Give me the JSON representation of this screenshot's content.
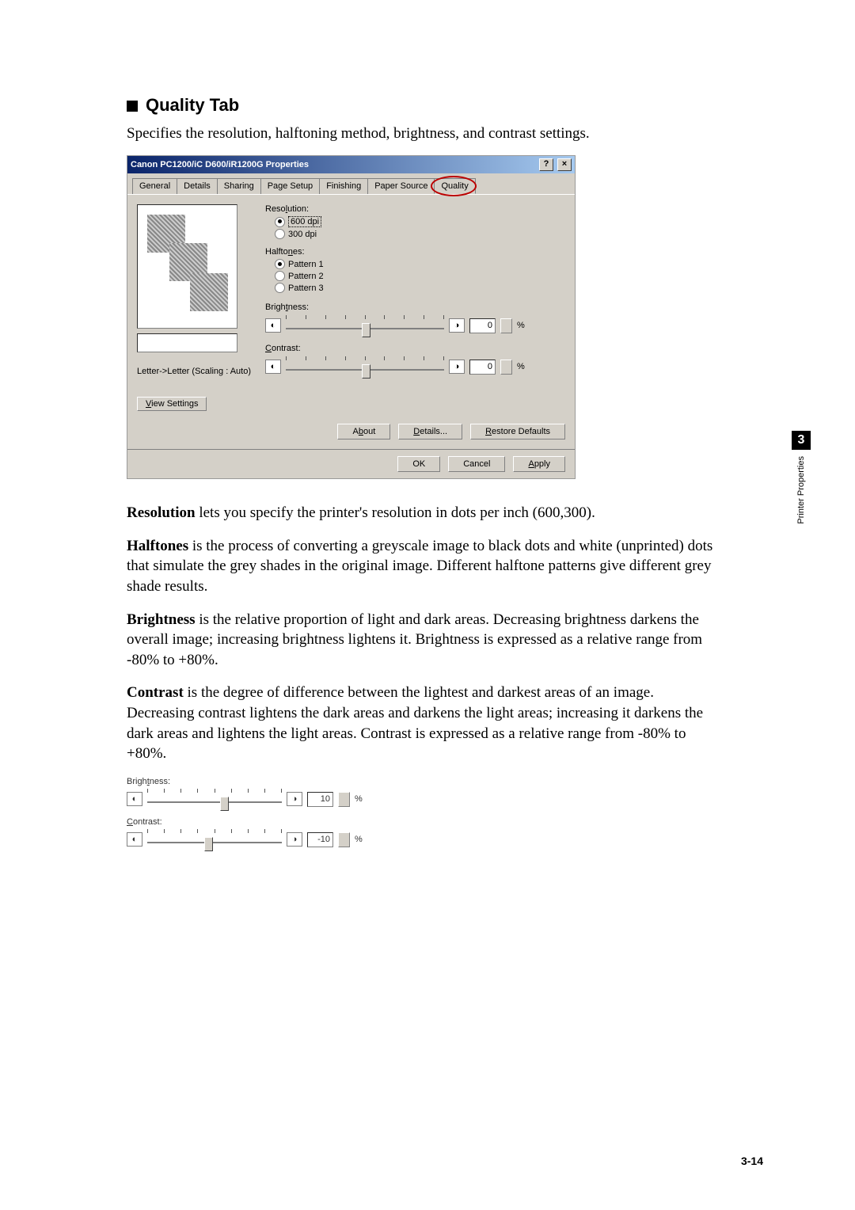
{
  "heading": "Quality Tab",
  "subtitle": "Specifies the resolution, halftoning method, brightness, and contrast settings.",
  "dialog": {
    "title": "Canon PC1200/iC D600/iR1200G Properties",
    "tabs": [
      "General",
      "Details",
      "Sharing",
      "Page Setup",
      "Finishing",
      "Paper Source",
      "Quality"
    ],
    "resolution": {
      "label": "Resolution:",
      "opt1": "600 dpi",
      "opt2": "300 dpi"
    },
    "halftones": {
      "label": "Halftones:",
      "opt1": "Pattern 1",
      "opt2": "Pattern 2",
      "opt3": "Pattern 3"
    },
    "brightness": {
      "label": "Brightness:",
      "value": "0"
    },
    "contrast": {
      "label": "Contrast:",
      "value": "0"
    },
    "scaleinfo": "Letter->Letter (Scaling : Auto)",
    "viewsettings": "View Settings",
    "about": "About",
    "details": "Details...",
    "restore": "Restore Defaults",
    "ok": "OK",
    "cancel": "Cancel",
    "apply": "Apply",
    "pct": "%"
  },
  "body": {
    "p1a": "Resolution",
    "p1b": " lets you specify the printer's resolution in dots per inch (600,300).",
    "p2a": "Halftones",
    "p2b": " is the process of converting a greyscale image to black dots and white (unprinted) dots that simulate the grey shades in the original image. Different halftone patterns give different grey shade results.",
    "p3a": "Brightness",
    "p3b": " is the relative proportion of light and dark areas. Decreasing brightness darkens the overall image; increasing brightness lightens it. Brightness is expressed as a relative range from -80% to +80%.",
    "p4a": "Contrast",
    "p4b": " is the degree of difference between the lightest and darkest areas of an image. Decreasing contrast lightens the dark areas and darkens the light areas; increasing it darkens the dark areas and lightens the light areas. Contrast is expressed as a relative range from -80% to +80%."
  },
  "mini": {
    "blabel": "Brightness:",
    "bval": "10",
    "clabel": "Contrast:",
    "cval": "-10",
    "pct": "%"
  },
  "side": {
    "num": "3",
    "text": "Printer Properties"
  },
  "pagenum": "3-14"
}
